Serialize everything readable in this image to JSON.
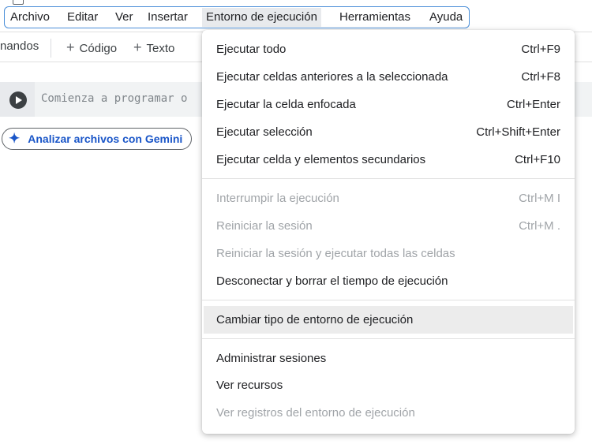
{
  "menubar": {
    "items": [
      {
        "label": "Archivo"
      },
      {
        "label": "Editar"
      },
      {
        "label": "Ver"
      },
      {
        "label": "Insertar"
      },
      {
        "label": "Entorno de ejecución",
        "active": true
      },
      {
        "label": "Herramientas"
      },
      {
        "label": "Ayuda"
      }
    ]
  },
  "toolbar": {
    "partial_label": "nandos",
    "add_code_label": "Código",
    "add_text_label": "Texto",
    "plus_glyph": "+"
  },
  "cell": {
    "placeholder": "Comienza a programar o",
    "run_icon": "play-circle-icon"
  },
  "gemini_button": {
    "label": "Analizar archivos con Gemini",
    "icon": "sparkle-icon",
    "glyph": "✦"
  },
  "runtime_menu": {
    "groups": [
      [
        {
          "label": "Ejecutar todo",
          "shortcut": "Ctrl+F9",
          "enabled": true
        },
        {
          "label": "Ejecutar celdas anteriores a la seleccionada",
          "shortcut": "Ctrl+F8",
          "enabled": true
        },
        {
          "label": "Ejecutar la celda enfocada",
          "shortcut": "Ctrl+Enter",
          "enabled": true
        },
        {
          "label": "Ejecutar selección",
          "shortcut": "Ctrl+Shift+Enter",
          "enabled": true
        },
        {
          "label": "Ejecutar celda y elementos secundarios",
          "shortcut": "Ctrl+F10",
          "enabled": true
        }
      ],
      [
        {
          "label": "Interrumpir la ejecución",
          "shortcut": "Ctrl+M I",
          "enabled": false
        },
        {
          "label": "Reiniciar la sesión",
          "shortcut": "Ctrl+M .",
          "enabled": false
        },
        {
          "label": "Reiniciar la sesión y ejecutar todas las celdas",
          "shortcut": "",
          "enabled": false
        },
        {
          "label": "Desconectar y borrar el tiempo de ejecución",
          "shortcut": "",
          "enabled": true
        }
      ],
      [
        {
          "label": "Cambiar tipo de entorno de ejecución",
          "shortcut": "",
          "enabled": true,
          "hovered": true
        }
      ],
      [
        {
          "label": "Administrar sesiones",
          "shortcut": "",
          "enabled": true
        },
        {
          "label": "Ver recursos",
          "shortcut": "",
          "enabled": true
        },
        {
          "label": "Ver registros del entorno de ejecución",
          "shortcut": "",
          "enabled": false
        }
      ]
    ]
  }
}
